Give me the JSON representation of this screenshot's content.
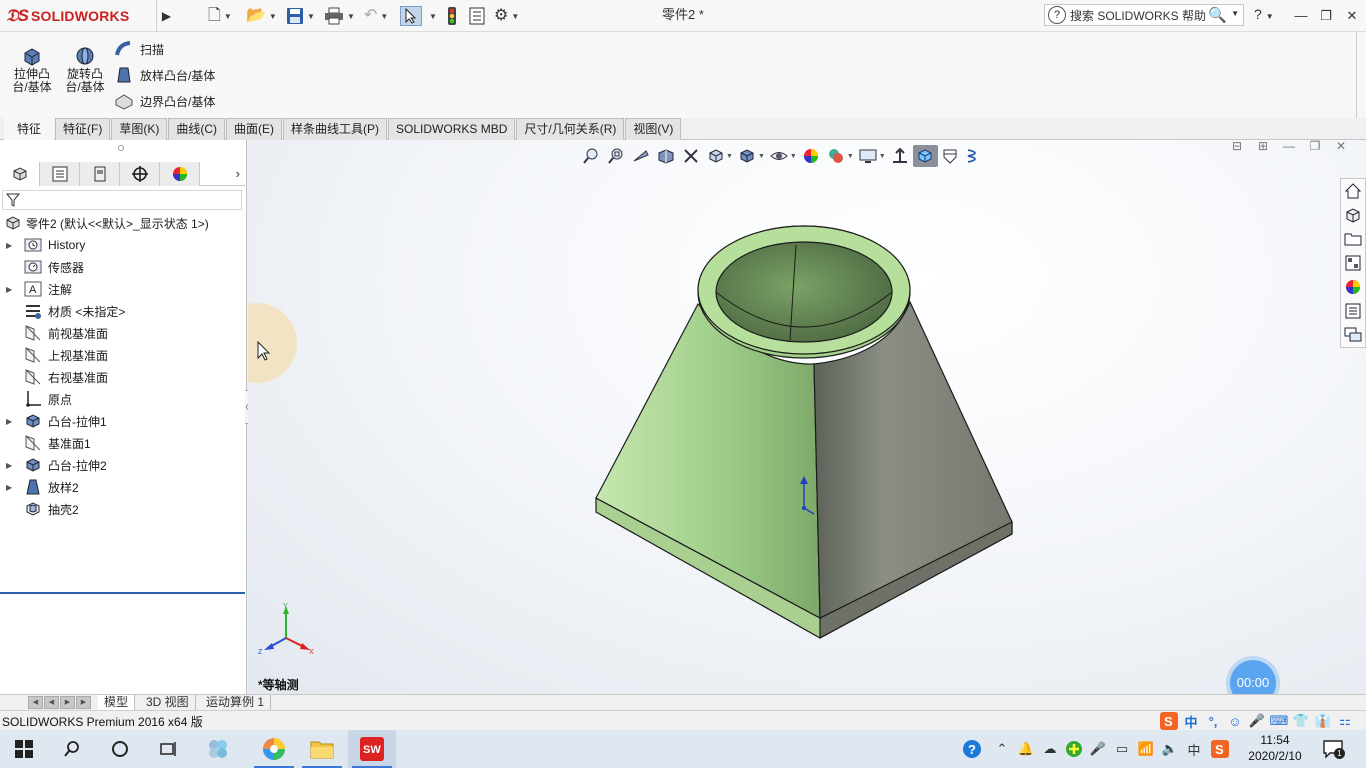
{
  "titlebar": {
    "brand_ds": "3S",
    "brand_name": "SOLIDWORKS",
    "document_title": "零件2 *",
    "search_placeholder": "搜索 SOLIDWORKS 帮助",
    "help_label": "?"
  },
  "ribbon": {
    "extrude_boss": "拉伸凸\n台/基体",
    "revolve_boss": "旋转凸\n台/基体",
    "sweep": "扫描",
    "loft_boss": "放样凸台/基体",
    "boundary_boss": "边界凸台/基体"
  },
  "command_tabs": [
    "特征",
    "特征(F)",
    "草图(K)",
    "曲线(C)",
    "曲面(E)",
    "样条曲线工具(P)",
    "SOLIDWORKS MBD",
    "尺寸/几何关系(R)",
    "视图(V)"
  ],
  "feature_tree": {
    "root": "零件2  (默认<<默认>_显示状态 1>)",
    "items": [
      {
        "label": "History",
        "icon": "history-folder-icon",
        "expandable": true
      },
      {
        "label": "传感器",
        "icon": "sensor-icon",
        "expandable": false
      },
      {
        "label": "注解",
        "icon": "annotation-icon",
        "expandable": true
      },
      {
        "label": "材质 <未指定>",
        "icon": "material-icon",
        "expandable": false
      },
      {
        "label": "前视基准面",
        "icon": "plane-icon",
        "expandable": false
      },
      {
        "label": "上视基准面",
        "icon": "plane-icon",
        "expandable": false
      },
      {
        "label": "右视基准面",
        "icon": "plane-icon",
        "expandable": false
      },
      {
        "label": "原点",
        "icon": "origin-icon",
        "expandable": false
      },
      {
        "label": "凸台-拉伸1",
        "icon": "extrude-feature-icon",
        "expandable": true
      },
      {
        "label": "基准面1",
        "icon": "plane-icon",
        "expandable": false
      },
      {
        "label": "凸台-拉伸2",
        "icon": "extrude-feature-icon",
        "expandable": true
      },
      {
        "label": "放样2",
        "icon": "loft-feature-icon",
        "expandable": true
      },
      {
        "label": "抽壳2",
        "icon": "shell-feature-icon",
        "expandable": false
      }
    ]
  },
  "viewport": {
    "view_name": "*等轴测",
    "triad_labels": {
      "x": "X",
      "y": "Y",
      "z": "Z"
    },
    "timer": "00:00",
    "colors": {
      "part_face": "#9fc98a",
      "part_shadow": "#6e7266",
      "background": "#eef1f5"
    }
  },
  "model_tabs": [
    "模型",
    "3D 视图",
    "运动算例 1"
  ],
  "status": {
    "text": "SOLIDWORKS Premium 2016 x64 版",
    "ime": [
      "中",
      "°,",
      "☺",
      "🎤",
      "⌨",
      "👕",
      "👔",
      "⚏"
    ]
  },
  "taskbar": {
    "time": "11:54",
    "date": "2020/2/10",
    "lang": "中",
    "notifications": "1"
  }
}
